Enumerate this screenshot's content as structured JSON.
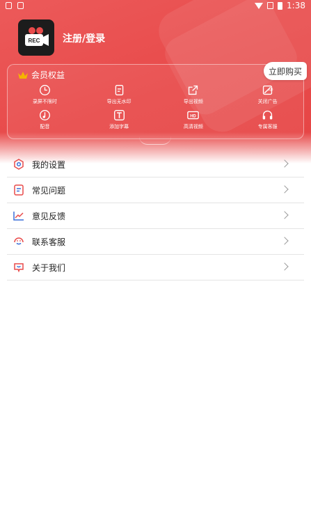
{
  "status": {
    "time": "1:38"
  },
  "profile": {
    "login_label": "注册/登录",
    "logo_text": "REC"
  },
  "vip": {
    "title": "会员权益",
    "buy_label": "立即购买",
    "perks": [
      {
        "label": "录屏不限时",
        "icon": "clock-icon"
      },
      {
        "label": "导出无水印",
        "icon": "document-icon"
      },
      {
        "label": "导出视频",
        "icon": "export-icon"
      },
      {
        "label": "关闭广告",
        "icon": "ad-icon"
      },
      {
        "label": "配音",
        "icon": "music-icon"
      },
      {
        "label": "添加字幕",
        "icon": "text-icon"
      },
      {
        "label": "高清视频",
        "icon": "hd-icon"
      },
      {
        "label": "专属客服",
        "icon": "headset-icon"
      }
    ]
  },
  "menu": [
    {
      "label": "我的设置",
      "icon": "settings-icon"
    },
    {
      "label": "常见问题",
      "icon": "faq-icon"
    },
    {
      "label": "意见反馈",
      "icon": "feedback-icon"
    },
    {
      "label": "联系客服",
      "icon": "service-icon"
    },
    {
      "label": "关于我们",
      "icon": "about-icon"
    }
  ],
  "colors": {
    "brand": "#e84a4a",
    "icon_accent": "#e84a4a",
    "gold": "#f5b400"
  }
}
